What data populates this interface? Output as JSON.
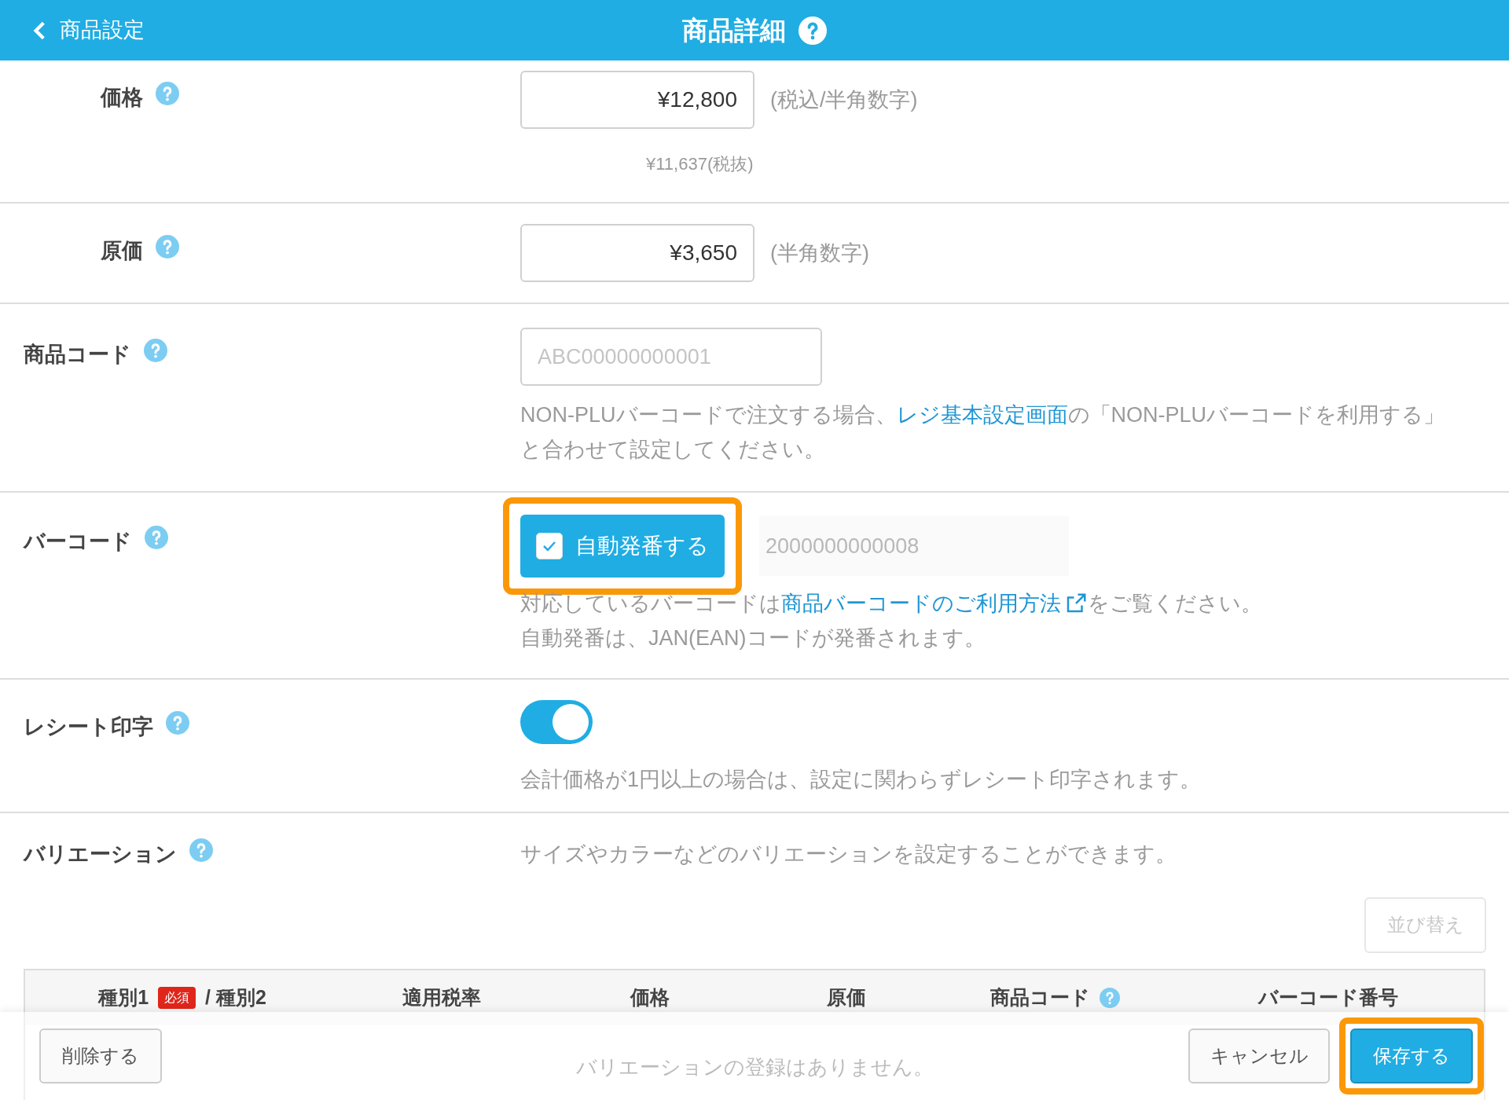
{
  "header": {
    "back_label": "商品設定",
    "title": "商品詳細"
  },
  "rows": [
    {
      "kind": "amount",
      "label": "価格",
      "value": "¥12,800",
      "note": "(税込/半角数字)",
      "subnote": "¥11,637(税抜)"
    },
    {
      "kind": "amount",
      "label": "原価",
      "value": "¥3,650",
      "note": "(半角数字)"
    },
    {
      "kind": "code",
      "label": "商品コード",
      "placeholder": "ABC00000000001",
      "lines": [
        [
          {
            "text": "NON-PLUバーコードで注文する場合、",
            "link": false
          },
          {
            "text": "レジ基本設定画面",
            "link": true,
            "external": false
          },
          {
            "text": "の「NON-PLUバーコードを利用する」",
            "link": false
          }
        ],
        [
          {
            "text": "と合わせて設定してください。",
            "link": false
          }
        ]
      ]
    },
    {
      "kind": "barcode",
      "label": "バーコード",
      "auto": {
        "label": "自動発番する",
        "checked": true,
        "highlighted": true
      },
      "placeholder": "2000000000008",
      "lines": [
        [
          {
            "text": "対応しているバーコードは",
            "link": false
          },
          {
            "text": "商品バーコードのご利用方法",
            "link": true,
            "external": true
          },
          {
            "text": "をご覧ください。",
            "link": false
          }
        ],
        [
          {
            "text": "自動発番は、JAN(EAN)コードが発番されます。",
            "link": false
          }
        ]
      ]
    },
    {
      "kind": "toggle",
      "label": "レシート印字",
      "on": true,
      "lines": [
        [
          {
            "text": "会計価格が1円以上の場合は、設定に関わらずレシート印字されます。",
            "link": false
          }
        ]
      ]
    }
  ],
  "variation": {
    "label": "バリエーション",
    "description": "サイズやカラーなどのバリエーションを設定することができます。",
    "sort_button": "並び替え",
    "columns": [
      {
        "label": "種別1",
        "badge": "必須",
        "suffix": "/ 種別2"
      },
      {
        "label": "適用税率"
      },
      {
        "label": "価格"
      },
      {
        "label": "原価"
      },
      {
        "label": "商品コード",
        "help": true
      },
      {
        "label": "バーコード番号"
      }
    ],
    "empty": "バリエーションの登録はありません。"
  },
  "footer": {
    "delete": "削除する",
    "cancel": "キャンセル",
    "save": {
      "label": "保存する",
      "highlighted": true
    }
  }
}
